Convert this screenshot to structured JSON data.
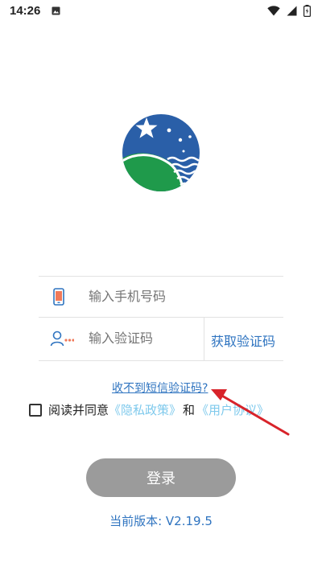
{
  "status_bar": {
    "time": "14:26"
  },
  "login": {
    "phone_placeholder": "输入手机号码",
    "code_placeholder": "输入验证码",
    "get_code_label": "获取验证码",
    "no_sms_link": "收不到短信验证码?",
    "agree_text": "阅读并同意",
    "privacy_link": "《隐私政策》",
    "and_text": "和",
    "user_agreement_link": "《用户协议》",
    "login_button": "登录",
    "version_text": "当前版本: V2.19.5"
  },
  "colors": {
    "accent": "#2f74c0",
    "link_light": "#7ec9ec",
    "button_disabled": "#9b9b9b",
    "annotation": "#d8232a"
  },
  "icons": {
    "notification": "image-notification-icon",
    "wifi": "wifi-icon",
    "signal": "cellular-signal-icon",
    "battery": "battery-icon",
    "phone": "phone-icon",
    "user_code": "user-code-icon"
  }
}
